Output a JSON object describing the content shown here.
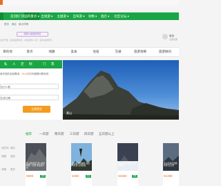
{
  "nav": {
    "items": [
      {
        "label": "首页"
      },
      {
        "label": "热门目的地 ▾"
      },
      {
        "label": "国内景点 ▾"
      },
      {
        "label": "出境游 ▾"
      },
      {
        "label": "主题游 ▾"
      },
      {
        "label": "自驾游 ▾"
      },
      {
        "label": "攻略 ▾"
      },
      {
        "label": "酒店 ▾"
      },
      {
        "label": "社区论坛 ▾"
      }
    ]
  },
  "breadcrumb": {
    "items": [
      "首页",
      "景区",
      "景点详情"
    ]
  },
  "tag": {
    "label": "国家5A级旅游景区"
  },
  "tag_note": "全年开放 · 适合春夏秋冬 · 建议游玩2-3天 · 实时在线预订",
  "user": {
    "name": "登录",
    "sub": "立即注册"
  },
  "tabs": [
    "目的地",
    "景点",
    "线路",
    "美食",
    "住宿",
    "交通",
    "旅游攻略",
    "旅游顾问"
  ],
  "form": {
    "head": [
      "私",
      "人",
      "定",
      "制",
      "门",
      "票"
    ],
    "desc_prefix": "填写您的定制需求，",
    "desc_highlight": "24小时",
    "desc_suffix": "内专属顾问联系您",
    "fields": [
      {
        "value": "出行人数"
      },
      {
        "value": "出发日期"
      },
      {
        "value": "联系电话"
      }
    ],
    "submit_label": "立即提交"
  },
  "hero": {
    "caption": "黄山"
  },
  "filter": {
    "items": [
      "推荐",
      "一日游",
      "两日游",
      "三日游",
      "四日游",
      "五日游以上"
    ]
  },
  "sidebar_links": [
    "目的地",
    "景区",
    "线路",
    "酒店",
    "攻略",
    "更多"
  ],
  "cards": [
    {
      "caption": "黄山风景区门票+索道 精选一日游 含往返大巴",
      "price": "¥608",
      "badge": "特惠"
    },
    {
      "caption": "黄山西海大峡谷 深度两日游 山顶住宿",
      "price": "¥498",
      "badge": "热卖"
    },
    {
      "caption": "黄山+宏村+西递 三日经典游",
      "price": "¥1550",
      "badge": "特惠"
    },
    {
      "caption": "黄山云海日出摄影团 五日游",
      "price": "¥1388",
      "badge": "热卖"
    }
  ]
}
